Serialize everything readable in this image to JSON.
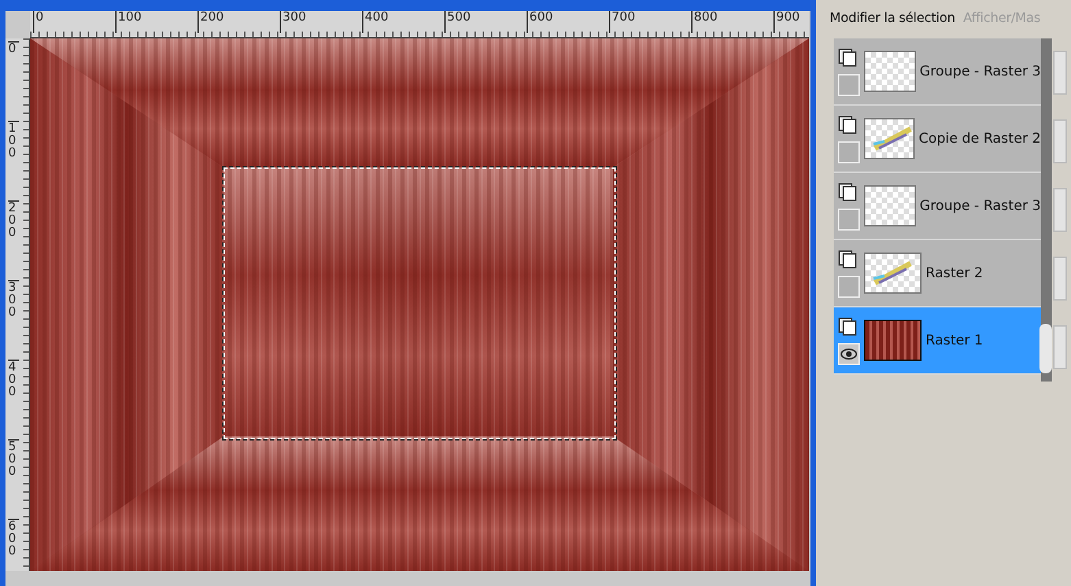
{
  "ruler_top": {
    "labels": [
      "0",
      "100",
      "200",
      "300",
      "400",
      "500",
      "600",
      "700",
      "800",
      "900"
    ]
  },
  "ruler_left": {
    "labels": [
      "0",
      "100",
      "200",
      "300",
      "400",
      "500",
      "600"
    ]
  },
  "canvas": {
    "selection": true
  },
  "layers_panel": {
    "tabs": [
      {
        "label": "Modifier la sélection",
        "selected": true
      },
      {
        "label": "Afficher/Mas",
        "selected": false
      }
    ],
    "layers": [
      {
        "name": "Groupe - Raster 3",
        "kind": "transparent",
        "visible": false,
        "selected": false
      },
      {
        "name": "Copie de Raster 2",
        "kind": "brush",
        "visible": false,
        "selected": false
      },
      {
        "name": "Groupe - Raster 3",
        "kind": "transparent",
        "visible": false,
        "selected": false
      },
      {
        "name": "Raster 2",
        "kind": "brush",
        "visible": false,
        "selected": false
      },
      {
        "name": "Raster 1",
        "kind": "background",
        "visible": true,
        "selected": true
      }
    ]
  }
}
